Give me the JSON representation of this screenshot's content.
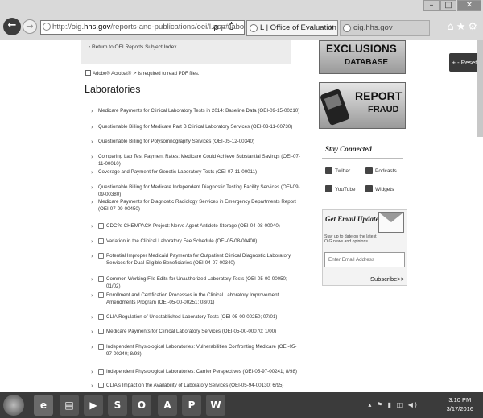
{
  "browser": {
    "address_scheme": "http://oig.",
    "address_host": "hhs.gov",
    "address_path": "/reports-and-publications/oei/l.asp#laboratories",
    "address_tools": "ρ - Ċ",
    "tabs": [
      {
        "label": "L | Office of Evaluation and ..."
      },
      {
        "label": "oig.hhs.gov"
      }
    ],
    "window_controls": {
      "minimize": "–",
      "maximize": "□",
      "close": "✕"
    },
    "tab_close": "×"
  },
  "main": {
    "return_link": "‹ Return to OEI Reports Subject Index",
    "adobe_note": "Adobe® Acrobat® ↗ is required to read PDF files.",
    "heading": "Laboratories",
    "items": [
      {
        "text": "Medicare Payments for Clinical Laboratory Tests in 2014: Baseline Data (OEI-09-15-00210)"
      },
      {
        "text": "Questionable Billing for Medicare Part B Clinical Laboratory Services (OEI-03-11-00730)"
      },
      {
        "text": "Questionable Billing for Polysomnography Services (OEI-05-12-00340)"
      },
      {
        "text": "Comparing Lab Test Payment Rates: Medicare Could Achieve Substantial Savings (OEI-07-11-00010)"
      },
      {
        "text": "Coverage and Payment for Genetic Laboratory Tests (OEI-07-11-00011)"
      },
      {
        "text": "Questionable Billing for Medicare Independent Diagnostic Testing Facility Services (OEI-09-09-00380)"
      },
      {
        "text": "Medicare Payments for Diagnostic Radiology Services in Emergency Departments Report (OEI-07-09-00450)"
      },
      {
        "text": "CDC?s CHEMPACK Project: Nerve Agent Antidote Storage (OEI-04-08-00040)"
      },
      {
        "text": "Variation in the Clinical Laboratory Fee Schedule (OEI-05-08-00400)"
      },
      {
        "text": "Potential Improper Medicaid Payments for Outpatient Clinical Diagnostic Laboratory Services for Dual-Eligible Beneficiaries (OEI-04-07-00340)"
      },
      {
        "text": "Common Working File Edits for Unauthorized Laboratory Tests (OEI-05-00-00050; 01/02)"
      },
      {
        "text": "Enrollment and Certification Processes in the Clinical Laboratory Improvement Amendments Program (OEI-05-00-00251; 08/01)"
      },
      {
        "text": "CLIA Regulation of Unestablished Laboratory Tests (OEI-05-00-00250; 07/01)"
      },
      {
        "text": "Medicare Payments for Clinical Laboratory Services (OEI-05-00-00070; 1/00)"
      },
      {
        "text": "Independent Physiological Laboratories: Vulnerabilities Confronting Medicare (OEI-05-97-00240; 8/98)"
      },
      {
        "text": "Independent Physiological Laboratories: Carrier Perspectives (OEI-05-97-00241; 8/98)"
      },
      {
        "text": "CLIA's Impact on the Availability of Laboratory Services (OEI-05-94-00130; 6/95)"
      }
    ]
  },
  "sidebar": {
    "exclusions_big": "EXCLUSIONS",
    "exclusions_small": "DATABASE",
    "fraud_big": "REPORT",
    "fraud_small": "FRAUD",
    "reset_label": "+ - Reset",
    "stay_connected": "Stay Connected",
    "social": {
      "twitter": "Twitter",
      "podcasts": "Podcasts",
      "youtube": "YouTube",
      "widgets": "Widgets"
    },
    "email_heading": "Get Email Updates",
    "email_sub": "Stay up to date on the latest OIG news and opinions",
    "email_placeholder": "Enter Email Address",
    "subscribe_label": "Subscribe>>"
  },
  "taskbar": {
    "apps": [
      {
        "icon": "internet-explorer-icon",
        "glyph": "e"
      },
      {
        "icon": "file-explorer-icon",
        "glyph": "▤"
      },
      {
        "icon": "media-player-icon",
        "glyph": "▶"
      },
      {
        "icon": "skype-icon",
        "glyph": "S"
      },
      {
        "icon": "outlook-icon",
        "glyph": "O"
      },
      {
        "icon": "acrobat-icon",
        "glyph": "A"
      },
      {
        "icon": "publisher-icon",
        "glyph": "P"
      },
      {
        "icon": "word-icon",
        "glyph": "W"
      }
    ],
    "time": "3:10 PM",
    "date": "3/17/2016"
  }
}
